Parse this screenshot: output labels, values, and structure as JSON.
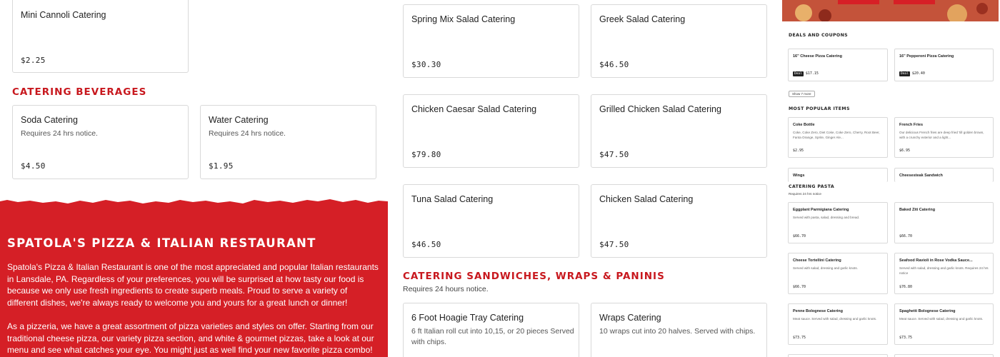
{
  "left_column": {
    "top_items": [
      {
        "name": "Mini Cannoli Catering",
        "price": "$2.25"
      }
    ],
    "beverages_heading": "CATERING BEVERAGES",
    "beverages": [
      {
        "name": "Soda Catering",
        "desc": "Requires 24 hrs notice.",
        "price": "$4.50"
      },
      {
        "name": "Water Catering",
        "desc": "Requires 24 hrs notice.",
        "price": "$1.95"
      }
    ]
  },
  "promo": {
    "title": "SPATOLA'S PIZZA & ITALIAN RESTAURANT",
    "paragraph1": "Spatola's Pizza & Italian Restaurant is one of the most appreciated and popular Italian restaurants in Lansdale, PA. Regardless of your preferences, you will be surprised at how tasty our food is because we only use fresh ingredients to create superb meals. Proud to serve a variety of different dishes, we're always ready to welcome you and yours for a great lunch or dinner!",
    "paragraph2": "As a pizzeria, we have a great assortment of pizza varieties and styles on offer. Starting from our traditional cheese pizza, our variety pizza section, and white & gourmet pizzas, take a look at our menu and see what catches your eye. You might just as well find your new favorite pizza combo!"
  },
  "middle_column": {
    "salads": [
      {
        "name": "Spring Mix Salad Catering",
        "price": "$30.30"
      },
      {
        "name": "Greek Salad Catering",
        "price": "$46.50"
      },
      {
        "name": "Chicken Caesar Salad Catering",
        "price": "$79.80"
      },
      {
        "name": "Grilled Chicken Salad Catering",
        "price": "$47.50"
      },
      {
        "name": "Tuna Salad Catering",
        "price": "$46.50"
      },
      {
        "name": "Chicken Salad Catering",
        "price": "$47.50"
      }
    ],
    "sandwiches_heading": "CATERING SANDWICHES, WRAPS & PANINIS",
    "sandwiches_subheading": "Requires 24 hours notice.",
    "sandwiches": [
      {
        "name": "6 Foot Hoagie Tray Catering",
        "desc": "6 ft Italian roll cut into 10,15, or 20 pieces Served with chips."
      },
      {
        "name": "Wraps Catering",
        "desc": "10 wraps cut into 20 halves. Served with chips."
      }
    ]
  },
  "right_panel": {
    "deals_heading": "DEALS AND COUPONS",
    "deals": [
      {
        "name": "16\" Cheese Pizza Catering",
        "badge": "Deal",
        "price": "$17.15"
      },
      {
        "name": "16\" Pepperoni Pizza Catering",
        "badge": "Deal",
        "price": "$20.40"
      }
    ],
    "show_more": "Show 7 more",
    "popular_heading": "MOST POPULAR ITEMS",
    "popular": [
      {
        "name": "Coke Bottle",
        "desc": "Coke, Coke Zero, Diet Coke, Coke Zero, Cherry, Root Beer, Fanta Orange, Sprite, Ginger Ale...",
        "price": "$2.95"
      },
      {
        "name": "French Fries",
        "desc": "Our delicious French fries are deep fried 'till golden brown, with a crunchy exterior and a light...",
        "price": "$6.95"
      },
      {
        "name": "Wings",
        "desc": "",
        "price": ""
      },
      {
        "name": "Cheesesteak Sandwich",
        "desc": "",
        "price": ""
      }
    ],
    "pasta_heading": "CATERING PASTA",
    "pasta_subheading": "Requires 24 hrs notice",
    "pasta": [
      {
        "name": "Eggplant Parmigiana Catering",
        "desc": "Served with pasta, salad, dressing and bread.",
        "price": "$66.70"
      },
      {
        "name": "Baked Ziti Catering",
        "desc": "",
        "price": "$66.70"
      },
      {
        "name": "Cheese Tortellini Catering",
        "desc": "Served with salad, dressing and garlic knots.",
        "price": "$66.70"
      },
      {
        "name": "Seafood Ravioli in Rose Vodka Sauce...",
        "desc": "Served with salad, dressing and garlic knots. Requires 24 hrs notice",
        "price": "$76.80"
      },
      {
        "name": "Penne Bolognese Catering",
        "desc": "Meat sauce. Served with salad, dressing and garlic knots.",
        "price": "$73.75"
      },
      {
        "name": "Spaghetti Bolognese Catering",
        "desc": "Meat sauce. Served with salad, dressing and garlic knots.",
        "price": "$73.75"
      }
    ]
  }
}
